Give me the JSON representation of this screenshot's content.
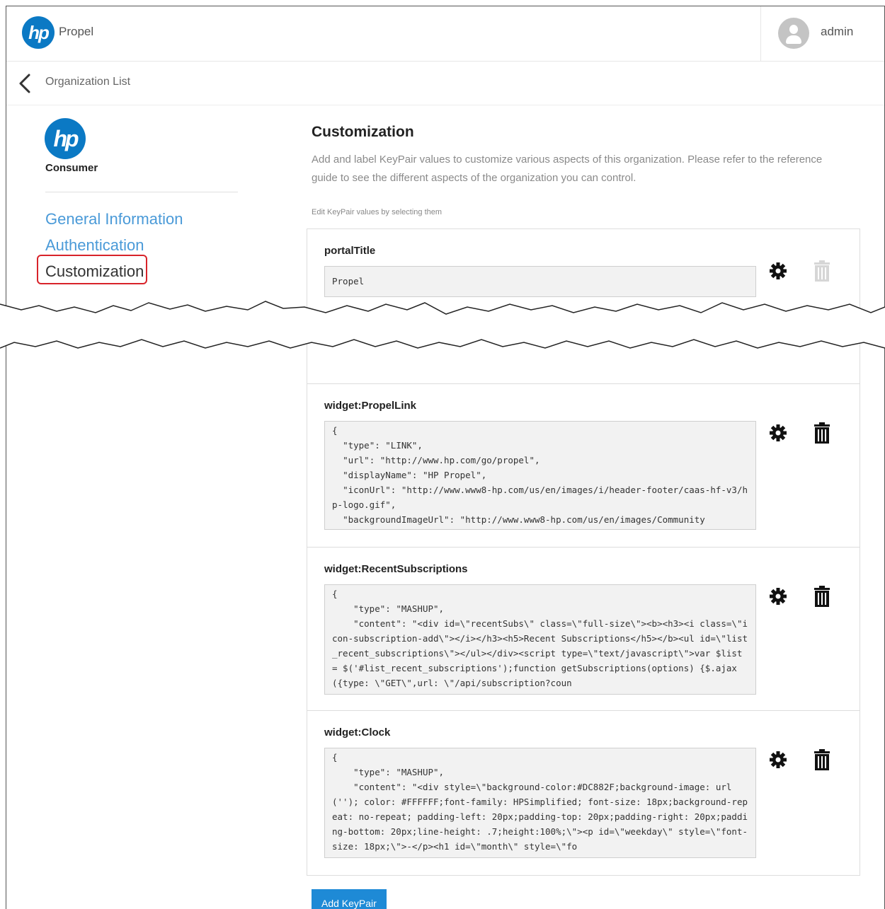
{
  "app": {
    "logo_text": "hp",
    "name": "Propel"
  },
  "user": {
    "name": "admin"
  },
  "breadcrumb": {
    "label": "Organization List"
  },
  "organization": {
    "logo_text": "hp",
    "name": "Consumer"
  },
  "nav": {
    "items": [
      {
        "label": "General Information"
      },
      {
        "label": "Authentication"
      },
      {
        "label": "Customization",
        "active": true
      }
    ]
  },
  "main": {
    "title": "Customization",
    "description": "Add and label KeyPair values to customize various aspects of this organization. Please refer to the reference guide to see the different aspects of the organization you can control.",
    "hint": "Edit KeyPair values by selecting them",
    "keypairs": [
      {
        "key": "portalTitle",
        "value": "Propel"
      },
      {
        "key": "widget:PropelLink",
        "value": "{\n  \"type\": \"LINK\",\n  \"url\": \"http://www.hp.com/go/propel\",\n  \"displayName\": \"HP Propel\",\n  \"iconUrl\": \"http://www.www8-hp.com/us/en/images/i/header-footer/caas-hf-v3/hp-logo.gif\",\n  \"backgroundImageUrl\": \"http://www.www8-hp.com/us/en/images/Community"
      },
      {
        "key": "widget:RecentSubscriptions",
        "value": "{\n    \"type\": \"MASHUP\",\n    \"content\": \"<div id=\\\"recentSubs\\\" class=\\\"full-size\\\"><b><h3><i class=\\\"icon-subscription-add\\\"></i></h3><h5>Recent Subscriptions</h5></b><ul id=\\\"list_recent_subscriptions\\\"></ul></div><script type=\\\"text/javascript\\\">var $list = $('#list_recent_subscriptions');function getSubscriptions(options) {$.ajax({type: \\\"GET\\\",url: \\\"/api/subscription?coun"
      },
      {
        "key": "widget:Clock",
        "value": "{\n    \"type\": \"MASHUP\",\n    \"content\": \"<div style=\\\"background-color:#DC882F;background-image: url(''); color: #FFFFFF;font-family: HPSimplified; font-size: 18px;background-repeat: no-repeat; padding-left: 20px;padding-top: 20px;padding-right: 20px;padding-bottom: 20px;line-height: .7;height:100%;\\\"><p id=\\\"weekday\\\" style=\\\"font-size: 18px;\\\">-</p><h1 id=\\\"month\\\" style=\\\"fo"
      }
    ],
    "add_button_label": "Add KeyPair"
  },
  "icons": {
    "settings": "gear-icon",
    "delete": "trash-icon",
    "back": "chevron-left-icon",
    "user": "user-avatar-icon"
  }
}
